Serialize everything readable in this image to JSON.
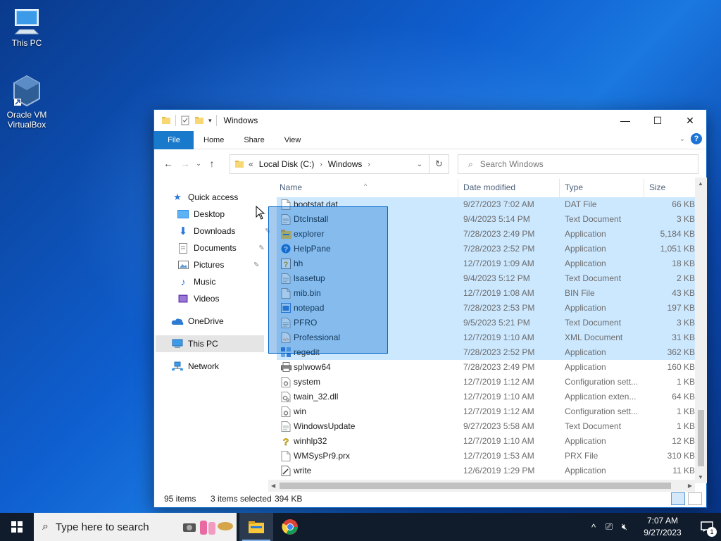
{
  "desktop": {
    "icons": [
      {
        "label": "This PC",
        "icon": "this-pc-icon"
      },
      {
        "label": "Oracle VM VirtualBox",
        "icon": "virtualbox-icon"
      }
    ]
  },
  "window": {
    "title": "Windows",
    "ribbon_tabs": [
      "File",
      "Home",
      "Share",
      "View"
    ],
    "help_label": "?",
    "address": {
      "overflow": "«",
      "crumbs": [
        "Local Disk (C:)",
        "Windows"
      ]
    },
    "search_placeholder": "Search Windows",
    "nav": {
      "quick_access": "Quick access",
      "items": [
        {
          "label": "Desktop",
          "pinned": true
        },
        {
          "label": "Downloads",
          "pinned": true
        },
        {
          "label": "Documents",
          "pinned": true
        },
        {
          "label": "Pictures",
          "pinned": true
        },
        {
          "label": "Music",
          "pinned": false
        },
        {
          "label": "Videos",
          "pinned": false
        }
      ],
      "onedrive": "OneDrive",
      "this_pc": "This PC",
      "network": "Network"
    },
    "columns": [
      "Name",
      "Date modified",
      "Type",
      "Size"
    ],
    "files": [
      {
        "name": "bootstat.dat",
        "date": "9/27/2023 7:02 AM",
        "type": "DAT File",
        "size": "66 KB",
        "selected": true,
        "icon": "file-icon"
      },
      {
        "name": "DtcInstall",
        "date": "9/4/2023 5:14 PM",
        "type": "Text Document",
        "size": "3 KB",
        "selected": true,
        "icon": "text-file-icon"
      },
      {
        "name": "explorer",
        "date": "7/28/2023 2:49 PM",
        "type": "Application",
        "size": "5,184 KB",
        "selected": true,
        "icon": "explorer-icon"
      },
      {
        "name": "HelpPane",
        "date": "7/28/2023 2:52 PM",
        "type": "Application",
        "size": "1,051 KB",
        "selected": true,
        "icon": "help-icon"
      },
      {
        "name": "hh",
        "date": "12/7/2019 1:09 AM",
        "type": "Application",
        "size": "18 KB",
        "selected": true,
        "icon": "hh-icon"
      },
      {
        "name": "lsasetup",
        "date": "9/4/2023 5:12 PM",
        "type": "Text Document",
        "size": "2 KB",
        "selected": true,
        "icon": "text-file-icon"
      },
      {
        "name": "mib.bin",
        "date": "12/7/2019 1:08 AM",
        "type": "BIN File",
        "size": "43 KB",
        "selected": true,
        "icon": "file-icon"
      },
      {
        "name": "notepad",
        "date": "7/28/2023 2:53 PM",
        "type": "Application",
        "size": "197 KB",
        "selected": true,
        "icon": "notepad-icon"
      },
      {
        "name": "PFRO",
        "date": "9/5/2023 5:21 PM",
        "type": "Text Document",
        "size": "3 KB",
        "selected": true,
        "icon": "text-file-icon"
      },
      {
        "name": "Professional",
        "date": "12/7/2019 1:10 AM",
        "type": "XML Document",
        "size": "31 KB",
        "selected": true,
        "icon": "xml-file-icon"
      },
      {
        "name": "regedit",
        "date": "7/28/2023 2:52 PM",
        "type": "Application",
        "size": "362 KB",
        "selected": true,
        "icon": "regedit-icon"
      },
      {
        "name": "splwow64",
        "date": "7/28/2023 2:49 PM",
        "type": "Application",
        "size": "160 KB",
        "selected": false,
        "icon": "printer-icon"
      },
      {
        "name": "system",
        "date": "12/7/2019 1:12 AM",
        "type": "Configuration sett...",
        "size": "1 KB",
        "selected": false,
        "icon": "config-file-icon"
      },
      {
        "name": "twain_32.dll",
        "date": "12/7/2019 1:10 AM",
        "type": "Application exten...",
        "size": "64 KB",
        "selected": false,
        "icon": "dll-file-icon"
      },
      {
        "name": "win",
        "date": "12/7/2019 1:12 AM",
        "type": "Configuration sett...",
        "size": "1 KB",
        "selected": false,
        "icon": "config-file-icon"
      },
      {
        "name": "WindowsUpdate",
        "date": "9/27/2023 5:58 AM",
        "type": "Text Document",
        "size": "1 KB",
        "selected": false,
        "icon": "text-file-icon"
      },
      {
        "name": "winhlp32",
        "date": "12/7/2019 1:10 AM",
        "type": "Application",
        "size": "12 KB",
        "selected": false,
        "icon": "winhlp-icon"
      },
      {
        "name": "WMSysPr9.prx",
        "date": "12/7/2019 1:53 AM",
        "type": "PRX File",
        "size": "310 KB",
        "selected": false,
        "icon": "file-icon"
      },
      {
        "name": "write",
        "date": "12/6/2019 1:29 PM",
        "type": "Application",
        "size": "11 KB",
        "selected": false,
        "icon": "write-icon"
      }
    ],
    "status": {
      "item_count": "95 items",
      "selected": "3 items selected",
      "selected_size": "394 KB"
    }
  },
  "taskbar": {
    "search_placeholder": "Type here to search",
    "clock_time": "7:07 AM",
    "clock_date": "9/27/2023",
    "notification_count": "1"
  }
}
